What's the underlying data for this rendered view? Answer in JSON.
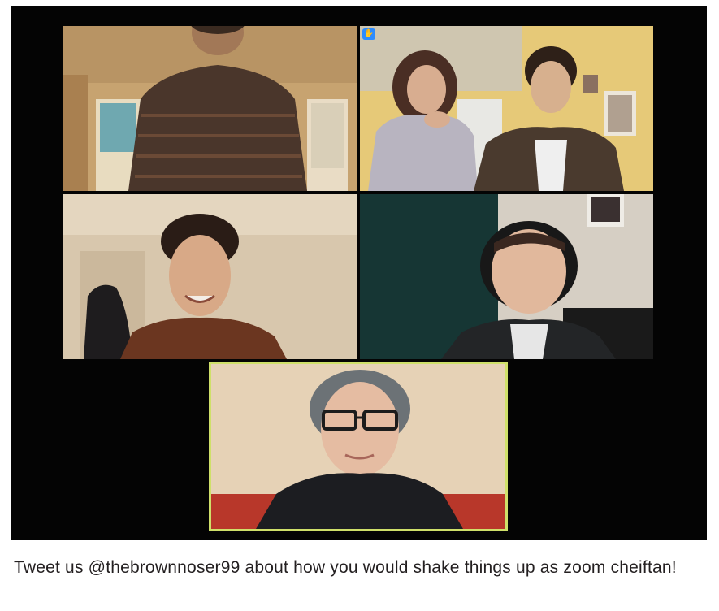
{
  "meeting": {
    "participants": [
      {
        "tile": "top-left",
        "state": "camera-on"
      },
      {
        "tile": "top-right",
        "state": "camera-on",
        "badge_icon": "raise-hand-icon"
      },
      {
        "tile": "middle-left",
        "state": "camera-on"
      },
      {
        "tile": "middle-right",
        "state": "camera-on"
      },
      {
        "tile": "bottom-center",
        "state": "active-speaker",
        "highlight_color": "#cfe06a"
      }
    ]
  },
  "caption": {
    "text": "Tweet us @thebrownnoser99 about how you would shake things up as zoom cheiftan!"
  },
  "colors": {
    "window_background": "#040404",
    "active_speaker_border": "#cfe06a",
    "badge_blue": "#2d8cff",
    "caption_text": "#231f20"
  }
}
